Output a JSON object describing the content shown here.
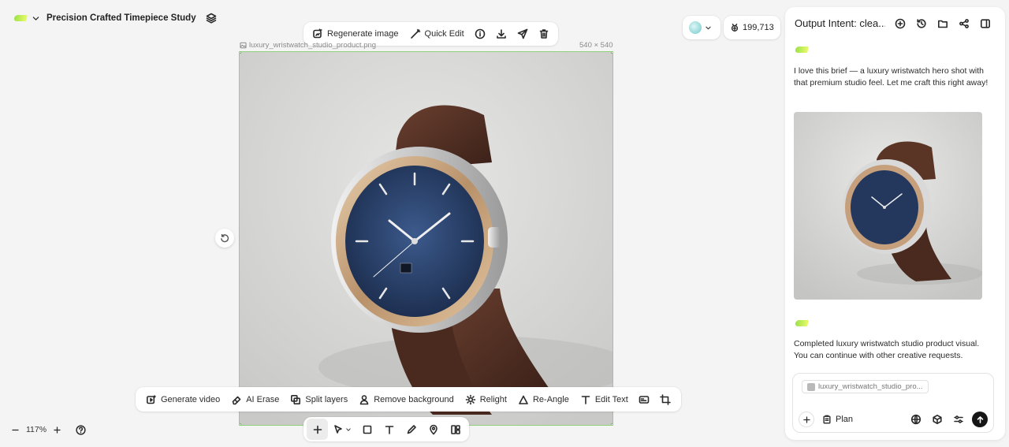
{
  "project": {
    "title": "Precision Crafted Timepiece Study"
  },
  "image_toolbar": {
    "regenerate": "Regenerate image",
    "quick_edit": "Quick Edit"
  },
  "canvas": {
    "file_name": "luxury_wristwatch_studio_product.png",
    "dimensions": "540 × 540",
    "zoom": "117%"
  },
  "credits": {
    "value": "199,713"
  },
  "edit_toolbar": {
    "generate_video": "Generate video",
    "ai_erase": "AI Erase",
    "split_layers": "Split layers",
    "remove_background": "Remove background",
    "relight": "Relight",
    "re_angle": "Re-Angle",
    "edit_text": "Edit Text"
  },
  "panel": {
    "title": "Output Intent: clea...",
    "message_1": "I love this brief — a luxury wristwatch hero shot with that premium studio feel. Let me craft this right away!",
    "message_2": "Completed luxury wristwatch studio product visual. You can continue with other creative requests.",
    "attachment": "luxury_wristwatch_studio_pro...",
    "mode": "Plan"
  },
  "colors": {
    "accent_green": "#8ed17a",
    "brand_gradient": [
      "#9be24a",
      "#e9f96a"
    ],
    "send_button": "#151515"
  }
}
